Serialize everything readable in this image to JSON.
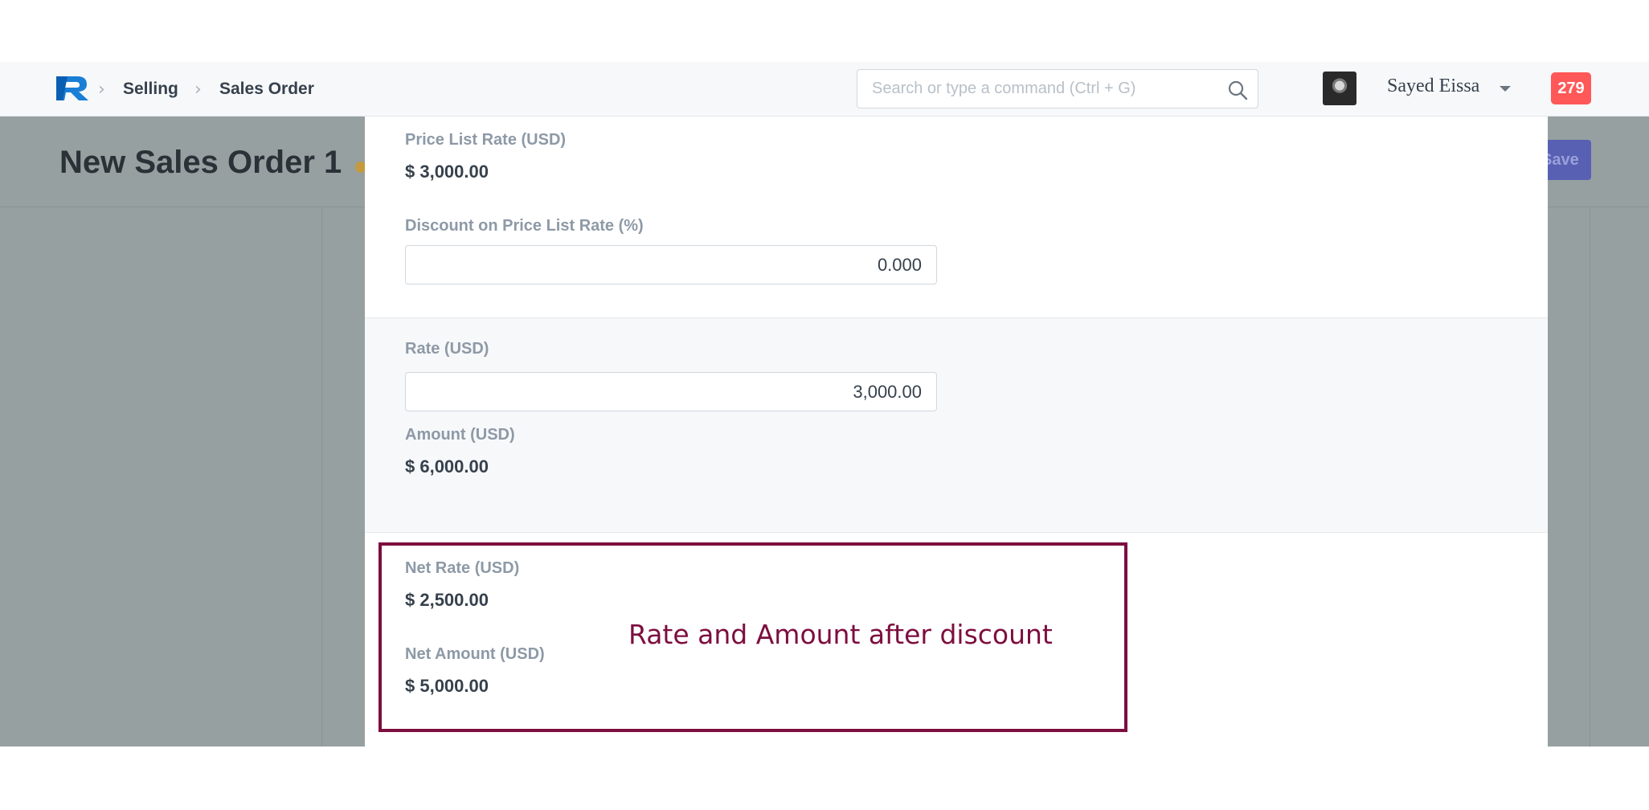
{
  "navbar": {
    "breadcrumbs": [
      "Selling",
      "Sales Order"
    ],
    "search_placeholder": "Search or type a command (Ctrl + G)",
    "user_name": "Sayed Eissa",
    "notification_count": "279"
  },
  "page": {
    "title": "New Sales Order 1",
    "save_label": "Save",
    "status_dot_color": "#c39a3e"
  },
  "modal": {
    "price_list_rate": {
      "label": "Price List Rate (USD)",
      "value": "$ 3,000.00"
    },
    "discount": {
      "label": "Discount on Price List Rate (%)",
      "value": "0.000"
    },
    "rate": {
      "label": "Rate (USD)",
      "value": "3,000.00"
    },
    "amount": {
      "label": "Amount (USD)",
      "value": "$ 6,000.00"
    },
    "net_rate": {
      "label": "Net Rate (USD)",
      "value": "$ 2,500.00"
    },
    "net_amount": {
      "label": "Net Amount (USD)",
      "value": "$ 5,000.00"
    }
  },
  "annotation": {
    "text": "Rate and Amount after discount",
    "color": "#7d0e3f"
  }
}
